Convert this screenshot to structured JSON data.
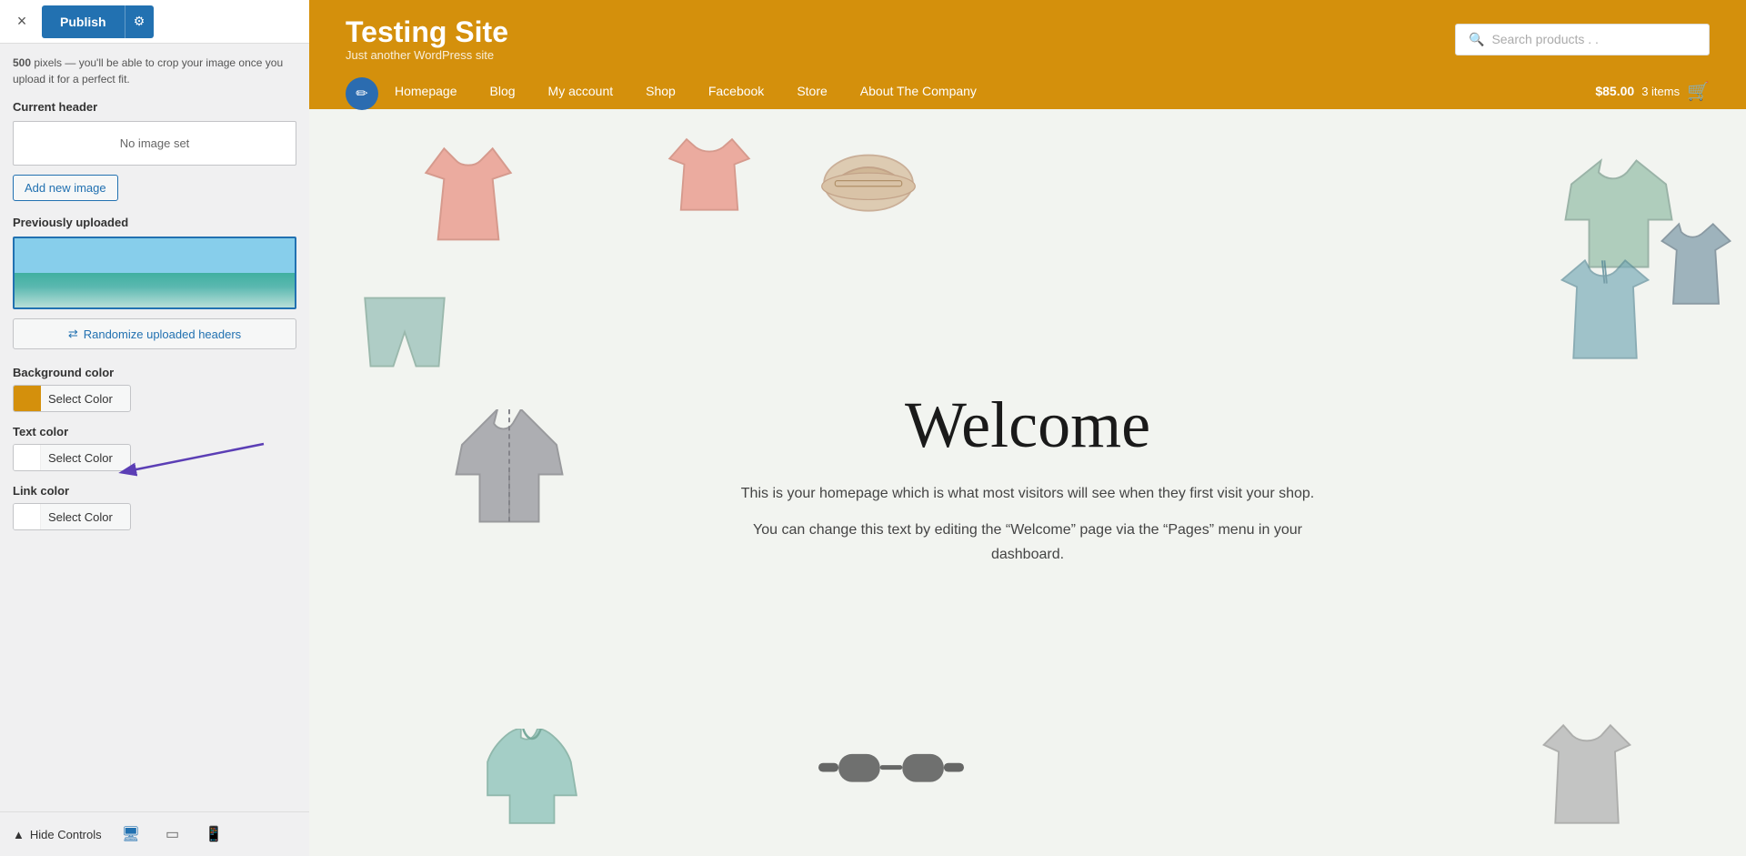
{
  "panel": {
    "close_label": "×",
    "note": "<strong>500</strong> pixels — you'll be able to crop your image once you upload it for a perfect fit.",
    "publish_label": "Publish",
    "settings_icon": "⚙",
    "current_header_label": "Current header",
    "no_image_label": "No image set",
    "add_image_label": "Add new image",
    "previously_uploaded_label": "Previously uploaded",
    "randomize_label": "Randomize uploaded headers",
    "background_color_label": "Background color",
    "background_color_swatch": "#d4900c",
    "background_select_label": "Select Color",
    "text_color_label": "Text color",
    "text_color_swatch": "#ffffff",
    "text_select_label": "Select Color",
    "link_color_label": "Link color",
    "link_color_swatch": "#ffffff",
    "link_select_label": "Select Color",
    "hide_controls_label": "Hide Controls",
    "device_desktop_icon": "🖥",
    "device_tablet_icon": "📱",
    "device_mobile_icon": "📲"
  },
  "site": {
    "title": "Testing Site",
    "tagline": "Just another WordPress site",
    "search_placeholder": "Search products . .",
    "nav_items": [
      {
        "label": "Homepage"
      },
      {
        "label": "Blog"
      },
      {
        "label": "My account"
      },
      {
        "label": "Shop"
      },
      {
        "label": "Facebook"
      },
      {
        "label": "Store"
      },
      {
        "label": "About The Company"
      }
    ],
    "cart_price": "$85.00",
    "cart_items": "3 items",
    "welcome_title": "Welcome",
    "welcome_text_1": "This is your homepage which is what most visitors will see when they first visit your shop.",
    "welcome_text_2": "You can change this text by editing the “Welcome” page via the “Pages” menu in your dashboard."
  },
  "colors": {
    "header_bg": "#d4900c",
    "accent_blue": "#2271b1"
  }
}
